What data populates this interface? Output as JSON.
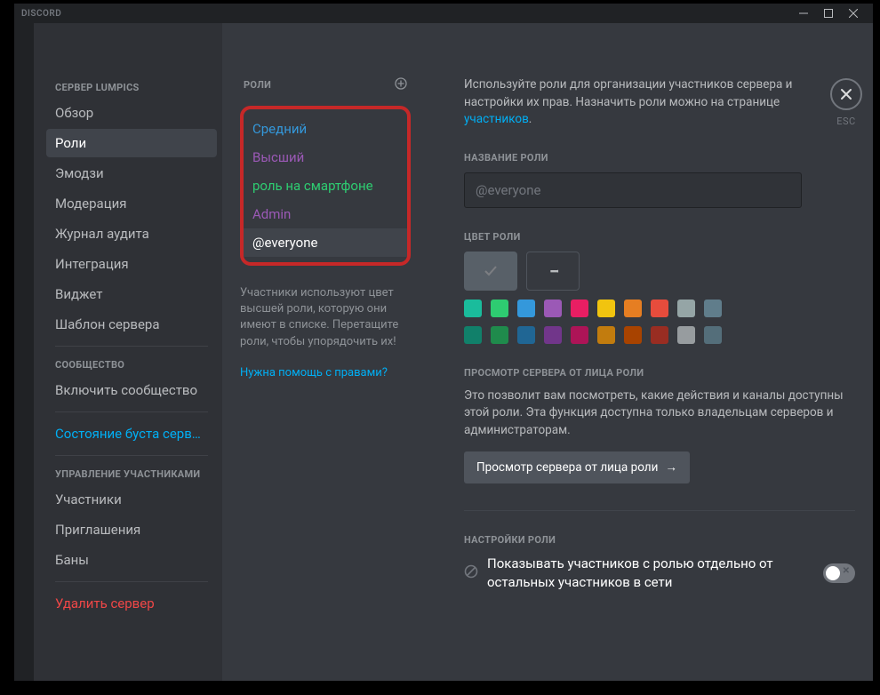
{
  "titlebar": {
    "title": "DISCORD"
  },
  "sidebar": {
    "section_server": "СЕРВЕР LUMPICS",
    "items_server": [
      "Обзор",
      "Роли",
      "Эмодзи",
      "Модерация",
      "Журнал аудита",
      "Интеграция",
      "Виджет",
      "Шаблон сервера"
    ],
    "section_community": "СООБЩЕСТВО",
    "items_community": [
      "Включить сообщество"
    ],
    "boost_status": "Состояние буста серв…",
    "section_members": "УПРАВЛЕНИЕ УЧАСТНИКАМИ",
    "items_members": [
      "Участники",
      "Приглашения",
      "Баны"
    ],
    "delete_server": "Удалить сервер"
  },
  "rolescol": {
    "title": "РОЛИ",
    "roles": [
      {
        "name": "Средний",
        "cls": "c-blue"
      },
      {
        "name": "Высший",
        "cls": "c-purple"
      },
      {
        "name": "роль на смартфоне",
        "cls": "c-green"
      },
      {
        "name": "Admin",
        "cls": "c-purple"
      },
      {
        "name": "@everyone",
        "cls": "selected"
      }
    ],
    "note": "Участники используют цвет высшей роли, которую они имеют в списке. Перетащите роли, чтобы упорядочить их!",
    "help": "Нужна помощь с правами?"
  },
  "content": {
    "intro_pre": "Используйте роли для организации участников сервера и настройки их прав. Назначить роли можно на странице ",
    "intro_link": "участников",
    "intro_post": ".",
    "role_name_label": "НАЗВАНИЕ РОЛИ",
    "role_name_value": "@everyone",
    "role_color_label": "ЦВЕТ РОЛИ",
    "colors_row1": [
      "#1abc9c",
      "#2ecc71",
      "#3498db",
      "#9b59b6",
      "#e91e63",
      "#f1c40f",
      "#e67e22",
      "#e74c3c",
      "#95a5a6",
      "#607d8b"
    ],
    "colors_row2": [
      "#11806a",
      "#1f8b4c",
      "#206694",
      "#71368a",
      "#ad1457",
      "#c27c0e",
      "#a84300",
      "#992d22",
      "#979c9f",
      "#546e7a"
    ],
    "preview_label": "ПРОСМОТР СЕРВЕРА ОТ ЛИЦА РОЛИ",
    "preview_desc": "Это позволит вам посмотреть, какие действия и каналы доступны этой роли. Эта функция доступна только владельцам серверов и администраторам.",
    "preview_btn": "Просмотр сервера от лица роли",
    "settings_label": "НАСТРОЙКИ РОЛИ",
    "setting_display": "Показывать участников с ролью отдельно от остальных участников в сети"
  },
  "esc": {
    "label": "ESC"
  }
}
